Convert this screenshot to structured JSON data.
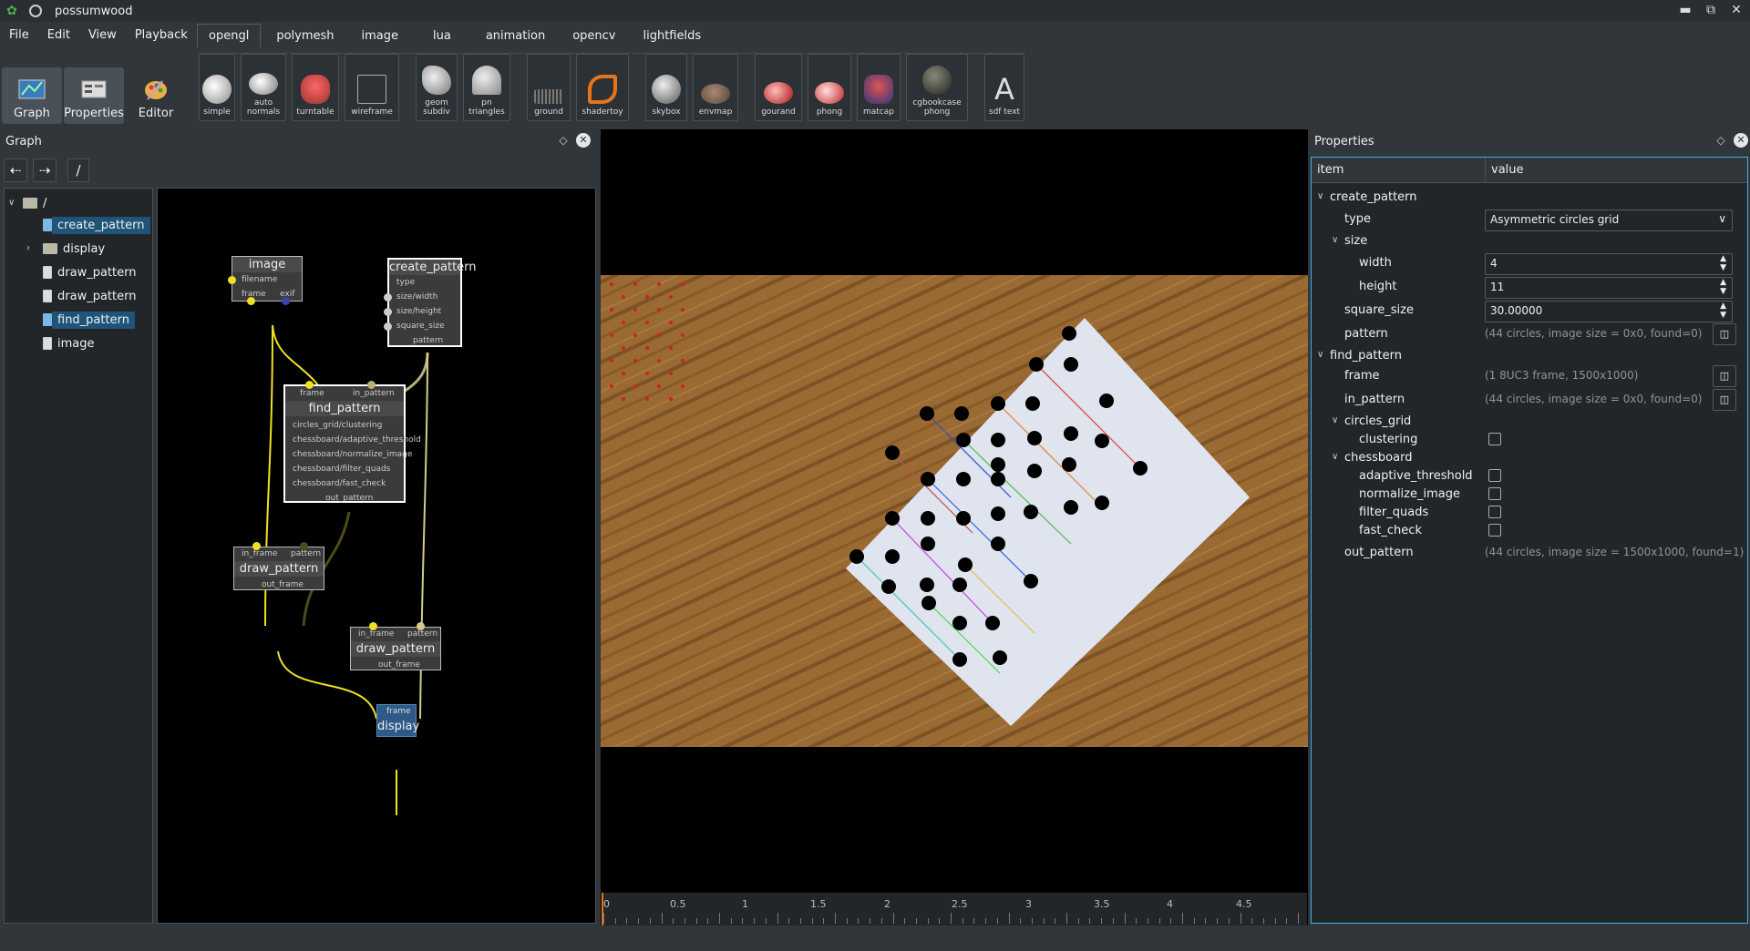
{
  "app": {
    "title": "possumwood"
  },
  "menu": [
    "File",
    "Edit",
    "View",
    "Playback"
  ],
  "tabs": [
    "opengl",
    "polymesh",
    "image",
    "lua",
    "animation",
    "opencv",
    "lightfields"
  ],
  "mode_buttons": [
    {
      "label": "Graph",
      "icon": "graph-icon"
    },
    {
      "label": "Properties",
      "icon": "properties-icon"
    },
    {
      "label": "Editor",
      "icon": "editor-icon"
    }
  ],
  "shelf": [
    {
      "label": "simple",
      "icon": "teapot-icon"
    },
    {
      "label": "auto normals",
      "icon": "teapot-icon"
    },
    {
      "label": "turntable",
      "icon": "car-icon"
    },
    {
      "label": "wireframe",
      "icon": "wireframe-cube-icon"
    },
    {
      "label": "geom subdiv",
      "icon": "shape-icon"
    },
    {
      "label": "pn triangles",
      "icon": "cone-icon"
    },
    {
      "label": "ground",
      "icon": "ground-icon"
    },
    {
      "label": "shadertoy",
      "icon": "swirl-icon"
    },
    {
      "label": "skybox",
      "icon": "sphere-icon"
    },
    {
      "label": "envmap",
      "icon": "teapot-icon"
    },
    {
      "label": "gourand",
      "icon": "teapot-red-icon"
    },
    {
      "label": "phong",
      "icon": "teapot-red-icon"
    },
    {
      "label": "matcap",
      "icon": "figure-icon"
    },
    {
      "label": "cgbookcase phong",
      "icon": "sphere-icon"
    },
    {
      "label": "sdf text",
      "icon": "letter-a-icon",
      "glyph": "A"
    }
  ],
  "graph_panel": {
    "title": "Graph",
    "path": "/",
    "tree": [
      "/",
      "create_pattern",
      "display",
      "draw_pattern",
      "draw_pattern",
      "find_pattern",
      "image"
    ]
  },
  "nodes": {
    "image": {
      "title": "image",
      "ports": [
        "filename",
        "frame",
        "exif"
      ]
    },
    "create_pattern": {
      "title": "create_pattern",
      "ports": [
        "type",
        "size/width",
        "size/height",
        "square_size",
        "pattern"
      ]
    },
    "find_pattern": {
      "title": "find_pattern",
      "in": [
        "frame",
        "in_pattern"
      ],
      "ports": [
        "circles_grid/clustering",
        "chessboard/adaptive_threshold",
        "chessboard/normalize_image",
        "chessboard/filter_quads",
        "chessboard/fast_check"
      ],
      "out": "out_pattern"
    },
    "draw1": {
      "title": "draw_pattern",
      "in": [
        "in_frame",
        "pattern"
      ],
      "out": "out_frame"
    },
    "draw2": {
      "title": "draw_pattern",
      "in": [
        "in_frame",
        "pattern"
      ],
      "out": "out_frame"
    },
    "display": {
      "title": "display",
      "in": "frame"
    }
  },
  "timeline": {
    "labels": [
      "0",
      "0.5",
      "1",
      "1.5",
      "2",
      "2.5",
      "3",
      "3.5",
      "4",
      "4.5"
    ]
  },
  "properties": {
    "title": "Properties",
    "col_item": "item",
    "col_value": "value",
    "rows": {
      "create_pattern": "create_pattern",
      "type": "type",
      "type_value": "Asymmetric circles grid",
      "size": "size",
      "width": "width",
      "width_value": "4",
      "height": "height",
      "height_value": "11",
      "square_size": "square_size",
      "square_size_value": "30.00000",
      "pattern": "pattern",
      "pattern_value": "(44 circles, image size = 0x0, found=0)",
      "find_pattern": "find_pattern",
      "frame": "frame",
      "frame_value": "(1 8UC3 frame, 1500x1000)",
      "in_pattern": "in_pattern",
      "in_pattern_value": "(44 circles, image size = 0x0, found=0)",
      "circles_grid": "circles_grid",
      "clustering": "clustering",
      "chessboard": "chessboard",
      "adaptive_threshold": "adaptive_threshold",
      "normalize_image": "normalize_image",
      "filter_quads": "filter_quads",
      "fast_check": "fast_check",
      "out_pattern": "out_pattern",
      "out_pattern_value": "(44 circles, image size = 1500x1000, found=1)"
    }
  },
  "colors": {
    "accent": "#3daee9",
    "selection": "#1d5478",
    "wire_yellow": "#f0e020",
    "node_display": "#2e5a87"
  }
}
